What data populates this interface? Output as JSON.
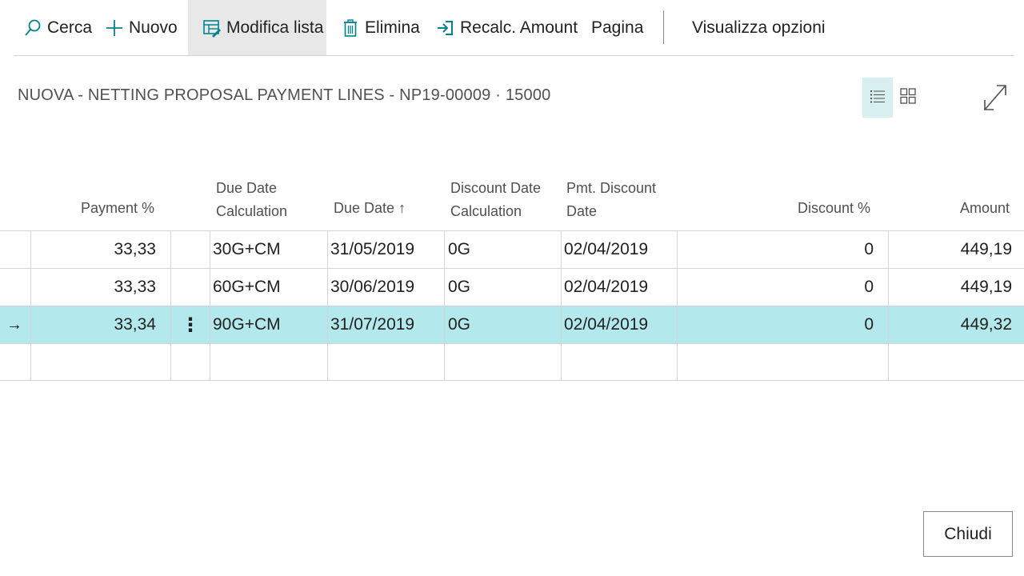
{
  "toolbar": {
    "search_label": "Cerca",
    "new_label": "Nuovo",
    "edit_list_label": "Modifica lista",
    "delete_label": "Elimina",
    "recalc_label": "Recalc. Amount",
    "page_label": "Pagina",
    "view_options_label": "Visualizza opzioni"
  },
  "page_title": "NUOVA - NETTING PROPOSAL PAYMENT LINES - NP19-00009 · 15000",
  "columns": {
    "payment_pct": "Payment %",
    "due_date_calc_1": "Due Date",
    "due_date_calc_2": "Calculation",
    "due_date": "Due Date",
    "due_date_sort_icon": "↑",
    "disc_date_calc_1": "Discount Date",
    "disc_date_calc_2": "Calculation",
    "pmt_disc_date_1": "Pmt. Discount",
    "pmt_disc_date_2": "Date",
    "discount_pct": "Discount %",
    "amount": "Amount"
  },
  "rows": [
    {
      "payment_pct": "33,33",
      "due_date_calc": "30G+CM",
      "due_date": "31/05/2019",
      "disc_date_calc": "0G",
      "pmt_disc_date": "02/04/2019",
      "discount_pct": "0",
      "amount": "449,19"
    },
    {
      "payment_pct": "33,33",
      "due_date_calc": "60G+CM",
      "due_date": "30/06/2019",
      "disc_date_calc": "0G",
      "pmt_disc_date": "02/04/2019",
      "discount_pct": "0",
      "amount": "449,19"
    },
    {
      "payment_pct": "33,34",
      "due_date_calc": "90G+CM",
      "due_date": "31/07/2019",
      "disc_date_calc": "0G",
      "pmt_disc_date": "02/04/2019",
      "discount_pct": "0",
      "amount": "449,32",
      "selected": true
    }
  ],
  "row_marker": "→",
  "row_menu": "⋮",
  "close_label": "Chiudi",
  "colors": {
    "selected_row": "#b3e8ec",
    "active_tool": "#e8e8e8",
    "accent": "#00838f"
  },
  "icons": [
    "search-icon",
    "plus-icon",
    "edit-list-icon",
    "trash-icon",
    "recalc-icon",
    "list-view-icon",
    "tile-view-icon",
    "expand-icon"
  ]
}
